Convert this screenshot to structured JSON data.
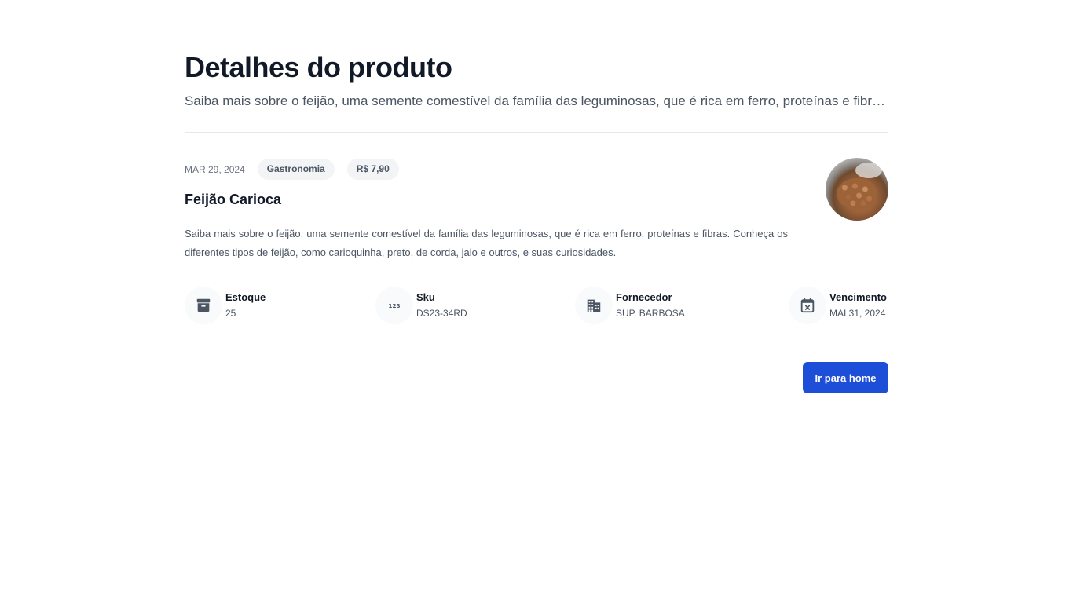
{
  "header": {
    "title": "Detalhes do produto",
    "subtitle": "Saiba mais sobre o feijão, uma semente comestível da família das leguminosas, que é rica em ferro, proteínas e fibras."
  },
  "product": {
    "date": "MAR 29, 2024",
    "category": "Gastronomia",
    "price": "R$ 7,90",
    "name": "Feijão Carioca",
    "description": "Saiba mais sobre o feijão, uma semente comestível da família das leguminosas, que é rica em ferro, proteínas e fibras. Conheça os diferentes tipos de feijão, como carioquinha, preto, de corda, jalo e outros, e suas curiosidades."
  },
  "stats": [
    {
      "label": "Estoque",
      "value": "25",
      "icon": "archive-box-icon"
    },
    {
      "label": "Sku",
      "value": "DS23-34RD",
      "icon": "numbers-123-icon"
    },
    {
      "label": "Fornecedor",
      "value": "SUP. BARBOSA",
      "icon": "building-icon"
    },
    {
      "label": "Vencimento",
      "value": "MAI 31, 2024",
      "icon": "calendar-x-icon"
    }
  ],
  "actions": {
    "home_label": "Ir para home"
  },
  "colors": {
    "primary": "#1d4ed8",
    "text": "#111827",
    "muted": "#4b5563",
    "icon": "#4b5563"
  }
}
